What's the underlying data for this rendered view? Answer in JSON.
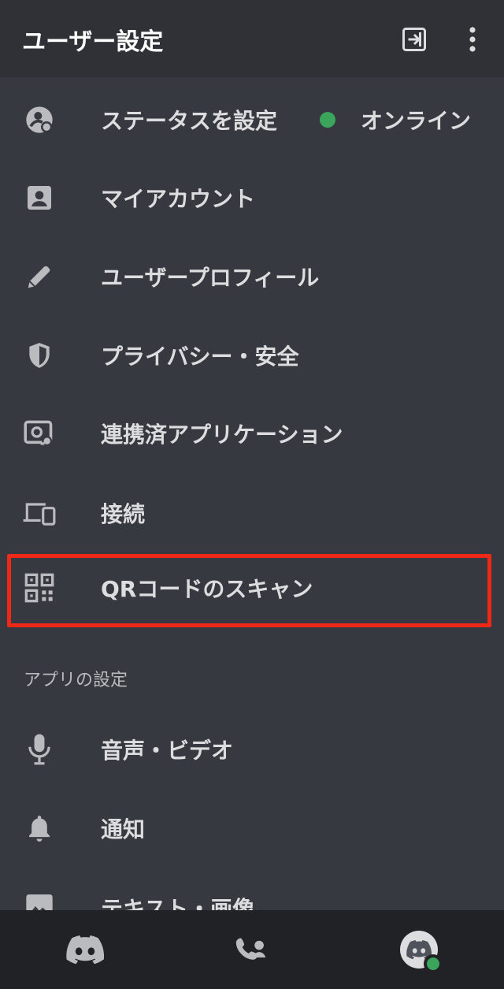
{
  "header": {
    "title": "ユーザー設定",
    "logout_icon": "logout-icon",
    "overflow_icon": "more-vertical-icon"
  },
  "user_settings": {
    "items": [
      {
        "label": "ステータスを設定",
        "icon": "status-icon",
        "value": "オンライン",
        "value_color": "#3ba55c"
      },
      {
        "label": "マイアカウント",
        "icon": "account-icon"
      },
      {
        "label": "ユーザープロフィール",
        "icon": "pencil-icon"
      },
      {
        "label": "プライバシー・安全",
        "icon": "shield-icon"
      },
      {
        "label": "連携済アプリケーション",
        "icon": "authorized-apps-icon"
      },
      {
        "label": "接続",
        "icon": "devices-icon"
      },
      {
        "label": "QRコードのスキャン",
        "icon": "qr-code-icon",
        "highlighted": true
      }
    ]
  },
  "app_settings": {
    "section_title": "アプリの設定",
    "items": [
      {
        "label": "音声・ビデオ",
        "icon": "microphone-icon"
      },
      {
        "label": "通知",
        "icon": "bell-icon"
      },
      {
        "label": "テキスト・画像",
        "icon": "image-icon"
      }
    ]
  },
  "bottom_nav": {
    "items": [
      {
        "icon": "discord-home-icon"
      },
      {
        "icon": "friends-icon"
      },
      {
        "icon": "profile-avatar-icon",
        "status": "online"
      }
    ]
  },
  "colors": {
    "background": "#36393f",
    "header_background": "#2f3136",
    "bottom_nav_background": "#202225",
    "highlight_border": "#f02818",
    "online_green": "#3ba55c"
  }
}
